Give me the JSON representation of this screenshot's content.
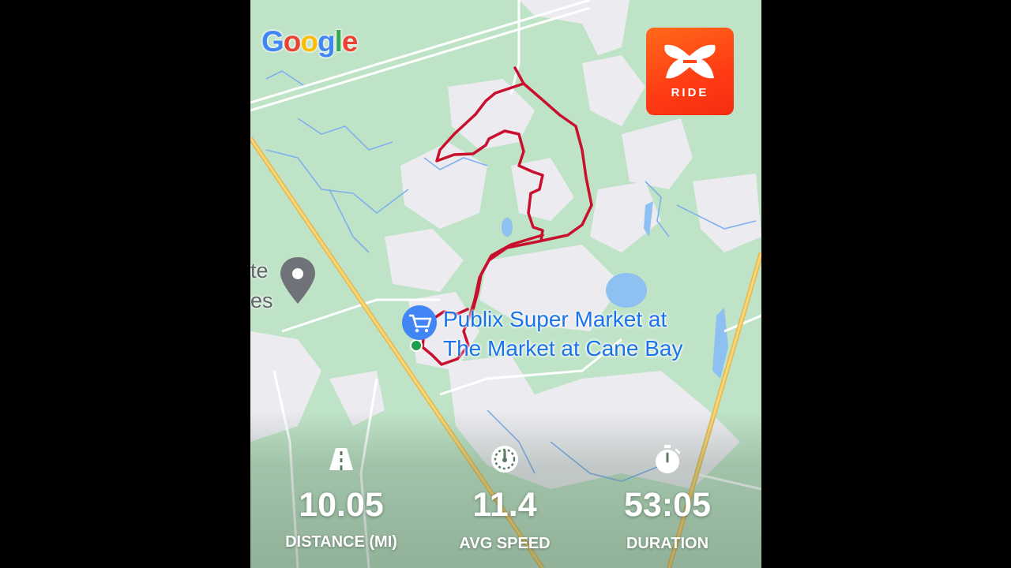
{
  "map": {
    "provider_logo": "Google",
    "place_name_line1": "Publix Super Market at",
    "place_name_line2": "The Market at Cane Bay",
    "partial_place_line1": "te",
    "partial_place_line2": "es",
    "place_icon": "shopping-cart-icon",
    "marker_icon": "map-pin-icon",
    "route_color": "#c8102e",
    "start_color": "#1e9e4a"
  },
  "app_badge": {
    "label": "RIDE",
    "icon": "under-armour-logo-icon",
    "color": "#ff4a18"
  },
  "stats": {
    "distance": {
      "value": "10.05",
      "label": "DISTANCE (MI)",
      "icon": "road-icon"
    },
    "avg_speed": {
      "value": "11.4",
      "label": "AVG SPEED",
      "icon": "speedometer-icon"
    },
    "duration": {
      "value": "53:05",
      "label": "DURATION",
      "icon": "stopwatch-icon"
    }
  }
}
